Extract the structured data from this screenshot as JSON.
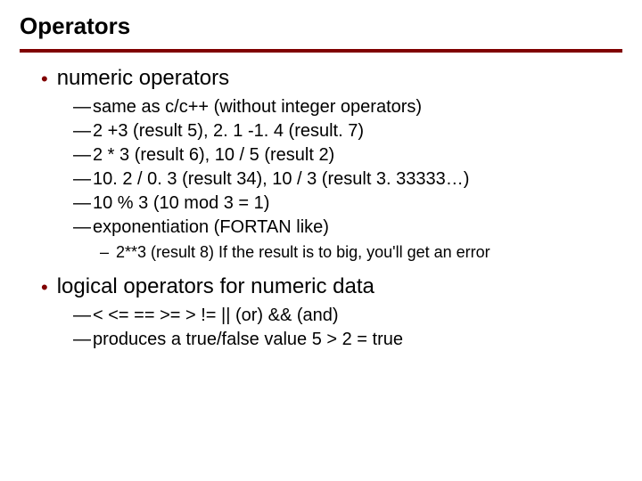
{
  "title": "Operators",
  "accent_color": "#800000",
  "bullets": [
    {
      "text": "numeric operators",
      "sub": [
        {
          "text": "same as c/c++ (without integer operators)"
        },
        {
          "text": "2 +3 (result 5), 2. 1 -1. 4 (result. 7)"
        },
        {
          "text": "2 * 3 (result 6), 10 / 5 (result 2)"
        },
        {
          "text": "10. 2 / 0. 3 (result 34), 10 / 3 (result 3. 33333…)"
        },
        {
          "text": "10 % 3 (10 mod 3 = 1)"
        },
        {
          "text": "exponentiation (FORTAN like)",
          "sub": [
            {
              "text": "2**3  (result 8)  If the result is to big, you'll get an error"
            }
          ]
        }
      ]
    },
    {
      "text": "logical operators for numeric data",
      "sub": [
        {
          "text": "< <= == >= > !=  || (or)  && (and)"
        },
        {
          "text": "produces a true/false value   5 > 2 = true"
        }
      ]
    }
  ]
}
